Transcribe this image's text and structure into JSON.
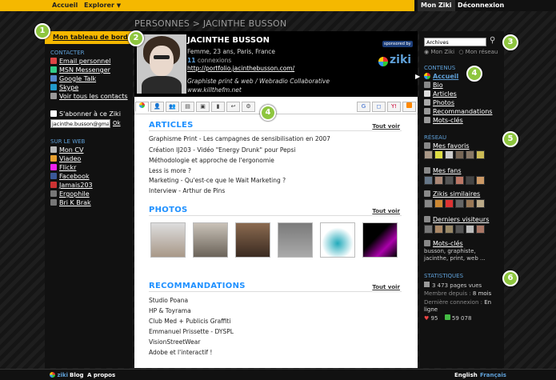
{
  "topbar": {
    "accueil": "Accueil",
    "explorer": "Explorer",
    "mon_ziki": "Mon Ziki",
    "deconnexion": "Déconnexion"
  },
  "breadcrumb": "PERSONNES > JACINTHE BUSSON",
  "left": {
    "dashboard": "Mon tableau de bord",
    "contacter_heading": "CONTACTER",
    "contact_links": [
      "Email personnel",
      "MSN Messenger",
      "Google Talk",
      "Skype",
      "Voir tous les contacts"
    ],
    "subscribe": "S'abonner à ce Ziki",
    "email_value": "jacinthe.busson@gmail.co",
    "ok": "Ok",
    "web_heading": "SUR LE WEB",
    "web_links": [
      "Mon CV",
      "Viadeo",
      "Flickr",
      "Facebook",
      "Jamais203",
      "Ergophile",
      "Bri K Brak"
    ]
  },
  "profile": {
    "name": "JACINTHE BUSSON",
    "info": "Femme, 23 ans, Paris, France",
    "connexions_count": "11",
    "connexions_label": "connexions",
    "url": "http://portfolio.jacinthebusson.com/",
    "tagline": "Graphiste print & web / Webradio Collaborative",
    "site": "www.killthefm.net",
    "sponsored": "sponsored by",
    "logo": "ziki"
  },
  "main": {
    "articles_title": "ARTICLES",
    "tout_voir": "Tout voir",
    "articles": [
      "Graphisme Print - Les campagnes de sensibilisation en 2007",
      "Création IJ203 - Vidéo \"Energy Drunk\" pour Pepsi",
      "Méthodologie et approche de l'ergonomie",
      "Less is more ?",
      "Marketing - Qu'est-ce que le Wait Marketing ?",
      "Interview - Arthur de Pins"
    ],
    "photos_title": "PHOTOS",
    "reco_title": "RECOMMANDATIONS",
    "recommandations": [
      "Studio Poana",
      "HP & Toyrama",
      "Club Med + Publicis Graffiti",
      "Emmanuel Prissette - DYSPL",
      "VisionStreetWear",
      "Adobe et l'interactif !"
    ]
  },
  "right": {
    "search_value": "Archives",
    "radio_mon_ziki": "Mon Ziki",
    "radio_mon_reseau": "Mon réseau",
    "contenus_heading": "CONTENUS",
    "contenus": [
      "Accueil",
      "Bio",
      "Articles",
      "Photos",
      "Recommandations",
      "Mots-clés"
    ],
    "reseau_heading": "RÉSEAU",
    "favoris": "Mes favoris",
    "fans": "Mes fans",
    "similaires": "Zikis similaires",
    "visiteurs": "Derniers visiteurs",
    "motscles": "Mots-clés",
    "motscles_text": "busson, graphiste, jacinthe, print, web ...",
    "stats_heading": "STATISTIQUES",
    "pages_vues": "3 473 pages vues",
    "membre_label": "Membre depuis :",
    "membre_value": "8 mois",
    "derniere_label": "Dernière connexion :",
    "derniere_value": "En ligne",
    "stat_a": "95",
    "stat_b": "59 078"
  },
  "bottombar": {
    "logo": "ziki",
    "blog": "Blog",
    "apropos": "A propos",
    "english": "English",
    "francais": "Français"
  },
  "badges": [
    "1",
    "2",
    "3",
    "4",
    "4",
    "5",
    "6"
  ],
  "colors": {
    "accent": "#f5b800",
    "link_blue": "#1e90ff",
    "badge_green": "#8ec63f"
  }
}
